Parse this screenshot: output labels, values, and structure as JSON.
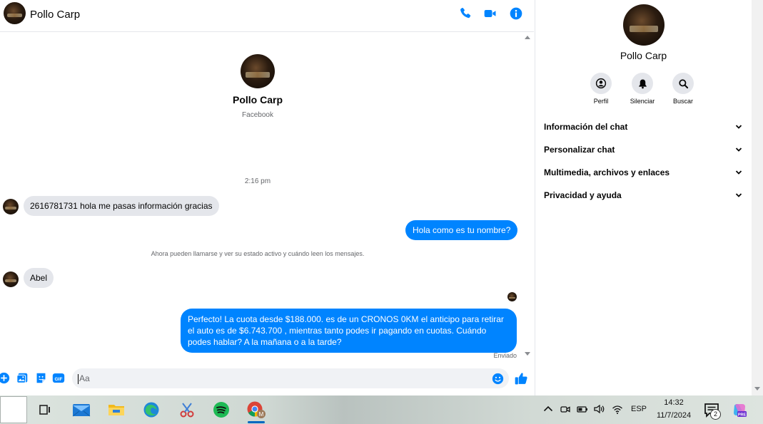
{
  "contact": {
    "name": "Pollo Carp",
    "source": "Facebook"
  },
  "header": {
    "actions": [
      "call-icon",
      "video-icon",
      "info-icon"
    ]
  },
  "conversation": {
    "timestamp": "2:16 pm",
    "messages": [
      {
        "direction": "in",
        "text": "2616781731 hola me pasas información gracias"
      },
      {
        "direction": "out",
        "text": "Hola como es tu nombre?"
      },
      {
        "direction": "system",
        "text": "Ahora pueden llamarse y ver su estado activo y cuándo leen los mensajes."
      },
      {
        "direction": "in",
        "text": "Abel"
      },
      {
        "direction": "out",
        "text": "Perfecto! La cuota desde $188.000. es de un CRONOS 0KM el anticipo para retirar el auto es de $6.743.700 , mientras tanto podes ir pagando en cuotas. Cuándo podes hablar? A la mañana o a la tarde?"
      }
    ],
    "status": "Enviado"
  },
  "composer": {
    "placeholder": "Aa",
    "gif_label": "GIF",
    "icons": [
      "plus-icon",
      "image-icon",
      "sticker-icon",
      "gif-icon",
      "emoji-icon",
      "like-icon"
    ]
  },
  "panel": {
    "name": "Pollo Carp",
    "actions": [
      {
        "label": "Perfil",
        "icon": "profile-icon"
      },
      {
        "label": "Silenciar",
        "icon": "bell-icon"
      },
      {
        "label": "Buscar",
        "icon": "search-icon"
      }
    ],
    "sections": [
      "Información del chat",
      "Personalizar chat",
      "Multimedia, archivos y enlaces",
      "Privacidad y ayuda"
    ]
  },
  "taskbar": {
    "apps": [
      "task-view-icon",
      "mail-icon",
      "file-explorer-icon",
      "edge-icon",
      "snipping-tool-icon",
      "spotify-icon",
      "chrome-icon"
    ],
    "chrome_profile": "M",
    "language": "ESP",
    "time": "14:32",
    "date": "11/7/2024",
    "notification_count": "2",
    "copilot_badge": "PRE"
  },
  "colors": {
    "accent": "#0084ff",
    "incoming_bubble": "#e4e6eb",
    "text": "#050505",
    "muted": "#65676b"
  }
}
